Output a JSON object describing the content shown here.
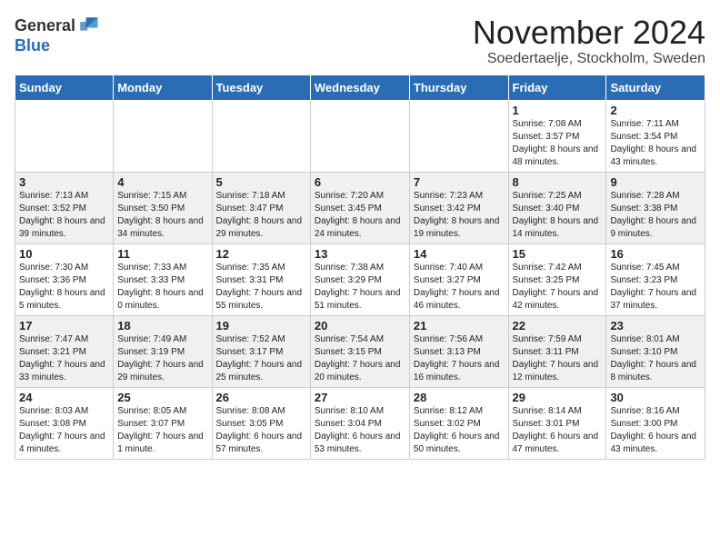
{
  "header": {
    "logo_general": "General",
    "logo_blue": "Blue",
    "title": "November 2024",
    "subtitle": "Soedertaelje, Stockholm, Sweden"
  },
  "weekdays": [
    "Sunday",
    "Monday",
    "Tuesday",
    "Wednesday",
    "Thursday",
    "Friday",
    "Saturday"
  ],
  "weeks": [
    [
      {
        "day": "",
        "info": ""
      },
      {
        "day": "",
        "info": ""
      },
      {
        "day": "",
        "info": ""
      },
      {
        "day": "",
        "info": ""
      },
      {
        "day": "",
        "info": ""
      },
      {
        "day": "1",
        "info": "Sunrise: 7:08 AM\nSunset: 3:57 PM\nDaylight: 8 hours and 48 minutes."
      },
      {
        "day": "2",
        "info": "Sunrise: 7:11 AM\nSunset: 3:54 PM\nDaylight: 8 hours and 43 minutes."
      }
    ],
    [
      {
        "day": "3",
        "info": "Sunrise: 7:13 AM\nSunset: 3:52 PM\nDaylight: 8 hours and 39 minutes."
      },
      {
        "day": "4",
        "info": "Sunrise: 7:15 AM\nSunset: 3:50 PM\nDaylight: 8 hours and 34 minutes."
      },
      {
        "day": "5",
        "info": "Sunrise: 7:18 AM\nSunset: 3:47 PM\nDaylight: 8 hours and 29 minutes."
      },
      {
        "day": "6",
        "info": "Sunrise: 7:20 AM\nSunset: 3:45 PM\nDaylight: 8 hours and 24 minutes."
      },
      {
        "day": "7",
        "info": "Sunrise: 7:23 AM\nSunset: 3:42 PM\nDaylight: 8 hours and 19 minutes."
      },
      {
        "day": "8",
        "info": "Sunrise: 7:25 AM\nSunset: 3:40 PM\nDaylight: 8 hours and 14 minutes."
      },
      {
        "day": "9",
        "info": "Sunrise: 7:28 AM\nSunset: 3:38 PM\nDaylight: 8 hours and 9 minutes."
      }
    ],
    [
      {
        "day": "10",
        "info": "Sunrise: 7:30 AM\nSunset: 3:36 PM\nDaylight: 8 hours and 5 minutes."
      },
      {
        "day": "11",
        "info": "Sunrise: 7:33 AM\nSunset: 3:33 PM\nDaylight: 8 hours and 0 minutes."
      },
      {
        "day": "12",
        "info": "Sunrise: 7:35 AM\nSunset: 3:31 PM\nDaylight: 7 hours and 55 minutes."
      },
      {
        "day": "13",
        "info": "Sunrise: 7:38 AM\nSunset: 3:29 PM\nDaylight: 7 hours and 51 minutes."
      },
      {
        "day": "14",
        "info": "Sunrise: 7:40 AM\nSunset: 3:27 PM\nDaylight: 7 hours and 46 minutes."
      },
      {
        "day": "15",
        "info": "Sunrise: 7:42 AM\nSunset: 3:25 PM\nDaylight: 7 hours and 42 minutes."
      },
      {
        "day": "16",
        "info": "Sunrise: 7:45 AM\nSunset: 3:23 PM\nDaylight: 7 hours and 37 minutes."
      }
    ],
    [
      {
        "day": "17",
        "info": "Sunrise: 7:47 AM\nSunset: 3:21 PM\nDaylight: 7 hours and 33 minutes."
      },
      {
        "day": "18",
        "info": "Sunrise: 7:49 AM\nSunset: 3:19 PM\nDaylight: 7 hours and 29 minutes."
      },
      {
        "day": "19",
        "info": "Sunrise: 7:52 AM\nSunset: 3:17 PM\nDaylight: 7 hours and 25 minutes."
      },
      {
        "day": "20",
        "info": "Sunrise: 7:54 AM\nSunset: 3:15 PM\nDaylight: 7 hours and 20 minutes."
      },
      {
        "day": "21",
        "info": "Sunrise: 7:56 AM\nSunset: 3:13 PM\nDaylight: 7 hours and 16 minutes."
      },
      {
        "day": "22",
        "info": "Sunrise: 7:59 AM\nSunset: 3:11 PM\nDaylight: 7 hours and 12 minutes."
      },
      {
        "day": "23",
        "info": "Sunrise: 8:01 AM\nSunset: 3:10 PM\nDaylight: 7 hours and 8 minutes."
      }
    ],
    [
      {
        "day": "24",
        "info": "Sunrise: 8:03 AM\nSunset: 3:08 PM\nDaylight: 7 hours and 4 minutes."
      },
      {
        "day": "25",
        "info": "Sunrise: 8:05 AM\nSunset: 3:07 PM\nDaylight: 7 hours and 1 minute."
      },
      {
        "day": "26",
        "info": "Sunrise: 8:08 AM\nSunset: 3:05 PM\nDaylight: 6 hours and 57 minutes."
      },
      {
        "day": "27",
        "info": "Sunrise: 8:10 AM\nSunset: 3:04 PM\nDaylight: 6 hours and 53 minutes."
      },
      {
        "day": "28",
        "info": "Sunrise: 8:12 AM\nSunset: 3:02 PM\nDaylight: 6 hours and 50 minutes."
      },
      {
        "day": "29",
        "info": "Sunrise: 8:14 AM\nSunset: 3:01 PM\nDaylight: 6 hours and 47 minutes."
      },
      {
        "day": "30",
        "info": "Sunrise: 8:16 AM\nSunset: 3:00 PM\nDaylight: 6 hours and 43 minutes."
      }
    ]
  ]
}
